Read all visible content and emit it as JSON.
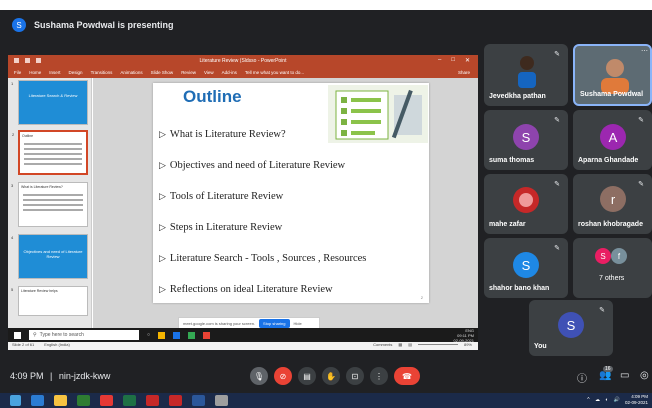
{
  "banner": {
    "avatar_letter": "S",
    "text": "Sushama Powdwal is presenting"
  },
  "ppt": {
    "window_title": "Literature Review (Sldsso - PowerPoint",
    "ribbon_tabs": [
      "File",
      "Home",
      "Insert",
      "Design",
      "Transitions",
      "Animations",
      "Slide Show",
      "Review",
      "View",
      "Add-ins",
      "Tell me what you want to do..."
    ],
    "share": "Share",
    "thumbnails": [
      {
        "num": "1",
        "title": "Literature Search & Review"
      },
      {
        "num": "2",
        "title": "Outline"
      },
      {
        "num": "3",
        "title": "What is Literature Review?"
      },
      {
        "num": "4",
        "title": "Objectives and need of Literature Review"
      },
      {
        "num": "5",
        "title": "Literature Review helps"
      }
    ],
    "slide": {
      "title": "Outline",
      "items": [
        "What is Literature Review?",
        "Objectives and need of  Literature  Review",
        "Tools of  Literature  Review",
        "Steps in  Literature  Review",
        "Literature Search -  Tools , Sources , Resources",
        "Reflections  on ideal  Literature  Review"
      ],
      "page": "2"
    },
    "sharebar": {
      "text": "meet.google.com is sharing your screen.",
      "stop": "Stop sharing",
      "hide": "Hide"
    },
    "status": {
      "left": "Slide 2 of 61",
      "lang": "English (India)",
      "comments": "Comments",
      "zoom": "89%"
    }
  },
  "inner_taskbar": {
    "search": "Type here to search",
    "clock_time": "09:11 PM",
    "clock_date": "02-09-2021",
    "lang": "ENG"
  },
  "participants": [
    {
      "name": "Jevedkha pathan",
      "letter": ""
    },
    {
      "name": "Sushama Powdwal",
      "letter": ""
    },
    {
      "name": "suma thomas",
      "letter": "S",
      "color": "#8e44ad"
    },
    {
      "name": "Aparna Ghandade",
      "letter": "A",
      "color": "#9c27b0"
    },
    {
      "name": "mahe zafar",
      "letter": ""
    },
    {
      "name": "roshan khobragade",
      "letter": "r",
      "color": "#8d6e63"
    },
    {
      "name": "shahor bano khan",
      "letter": "S",
      "color": "#1e88e5"
    },
    {
      "name": "7 others",
      "letter": ""
    },
    {
      "name": "You",
      "letter": "S",
      "color": "#3f51b5"
    }
  ],
  "others_avatars": [
    "S",
    "f"
  ],
  "bottombar": {
    "time": "4:09 PM",
    "separator": "|",
    "code": "nin-jzdk-kww",
    "participants_count": "16"
  },
  "win_clock": {
    "time": "4:09 PM",
    "date": "02-09-2021"
  }
}
